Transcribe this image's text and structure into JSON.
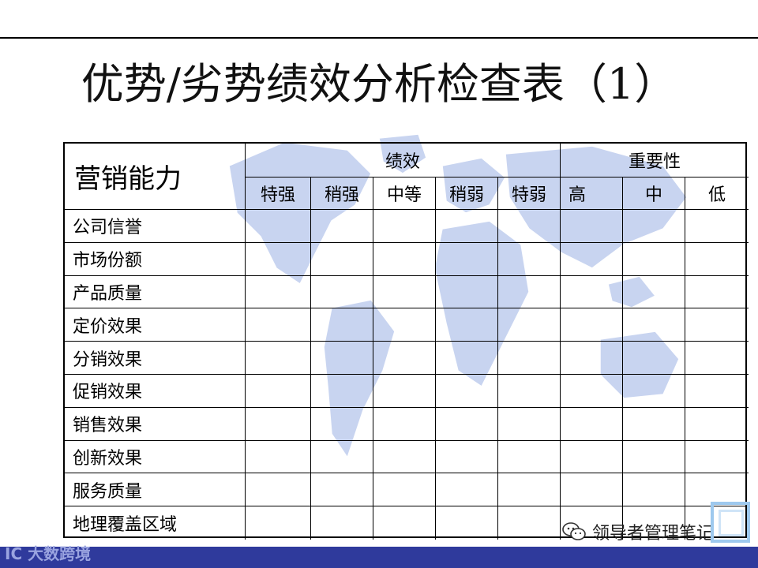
{
  "title": "优势/劣势绩效分析检查表（1）",
  "colors": {
    "map": "#c8d4f0",
    "bottom_bar": "#2f3a9c",
    "accent_box": "#9ec9ee"
  },
  "table": {
    "corner_label": "营销能力",
    "group_performance": "绩效",
    "group_importance": "重要性",
    "performance_levels": [
      "特强",
      "稍强",
      "中等",
      "稍弱",
      "特弱"
    ],
    "importance_levels": [
      "高",
      "中",
      "低"
    ],
    "rows": [
      "公司信誉",
      "市场份额",
      "产品质量",
      "定价效果",
      "分销效果",
      "促销效果",
      "销售效果",
      "创新效果",
      "服务质量",
      "地理覆盖区域"
    ]
  },
  "footer": {
    "logo_text": "大数跨境",
    "logo_mark": "IC",
    "watermark_text": "领导者管理笔记",
    "watermark_icon": "wechat-icon"
  }
}
